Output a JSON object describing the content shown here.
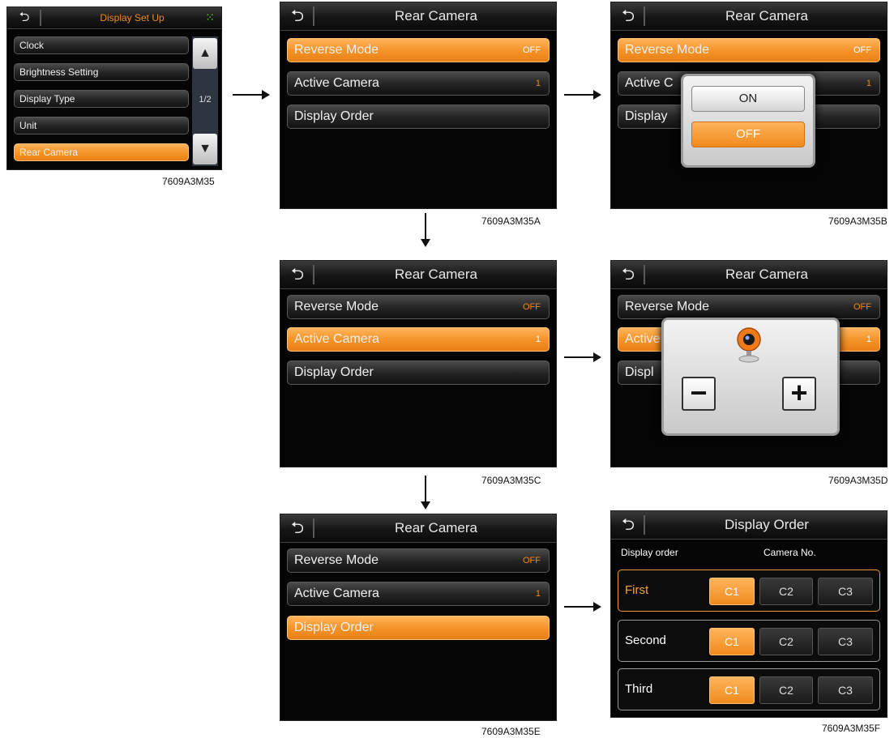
{
  "display_setup": {
    "title": "Display Set Up",
    "items": [
      "Clock",
      "Brightness Setting",
      "Display Type",
      "Unit",
      "Rear Camera"
    ],
    "selected_index": 4,
    "page": "1/2",
    "caption": "7609A3M35"
  },
  "rear_camera": {
    "title": "Rear Camera",
    "reverse_mode_label": "Reverse Mode",
    "reverse_mode_value": "OFF",
    "active_camera_label": "Active Camera",
    "active_camera_value": "1",
    "display_order_label": "Display Order"
  },
  "captions": {
    "a": "7609A3M35A",
    "b": "7609A3M35B",
    "c": "7609A3M35C",
    "d": "7609A3M35D",
    "e": "7609A3M35E",
    "f": "7609A3M35F"
  },
  "reverse_popup": {
    "on": "ON",
    "off": "OFF"
  },
  "b_truncated": {
    "active": "Active C",
    "display": "Display"
  },
  "d_truncated": {
    "active": "Active",
    "display": "Displ"
  },
  "camera_popup": {
    "minus": "−",
    "plus": "+"
  },
  "display_order_screen": {
    "title": "Display Order",
    "col_order": "Display order",
    "col_camera": "Camera No.",
    "rows": [
      {
        "label": "First",
        "buttons": [
          "C1",
          "C2",
          "C3"
        ]
      },
      {
        "label": "Second",
        "buttons": [
          "C1",
          "C2",
          "C3"
        ]
      },
      {
        "label": "Third",
        "buttons": [
          "C1",
          "C2",
          "C3"
        ]
      }
    ]
  },
  "colors": {
    "accent": "#f08a1c",
    "background": "#050505"
  }
}
